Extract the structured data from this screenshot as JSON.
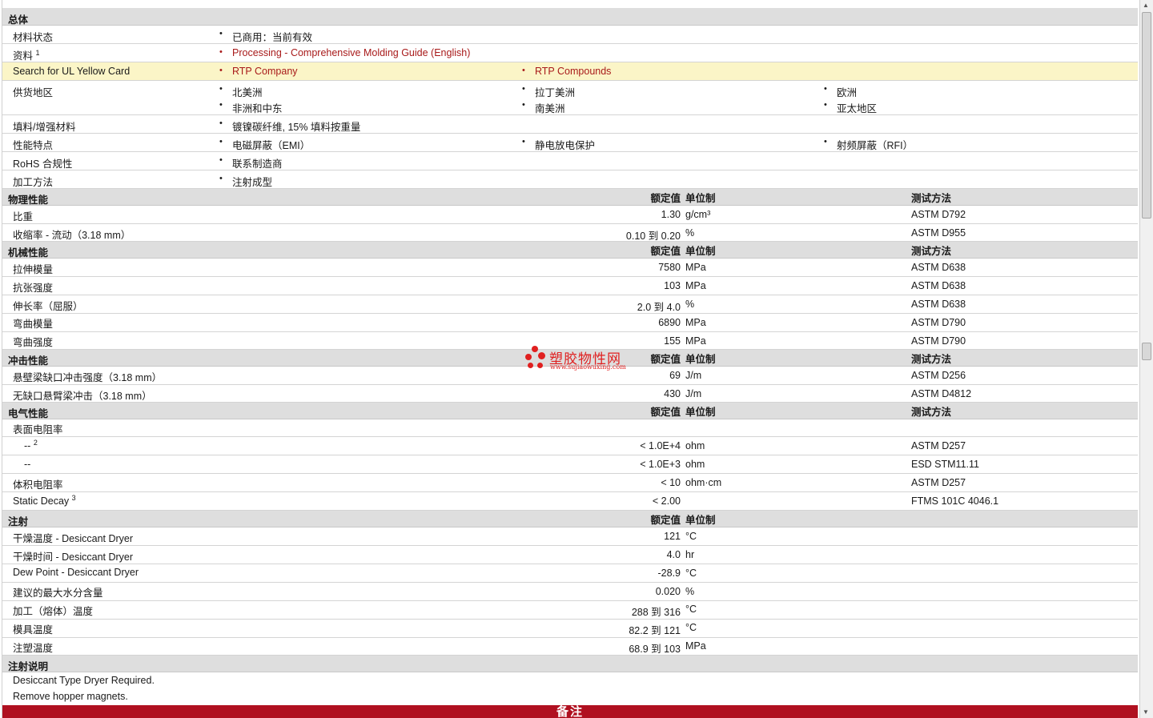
{
  "general": {
    "title": "总体",
    "status_label": "材料状态",
    "status_value": "已商用：当前有效",
    "docs_label": "资料",
    "docs_sup": "1",
    "docs_link": "Processing - Comprehensive Molding Guide (English)",
    "ul_label": "Search for UL Yellow Card",
    "ul_link1": "RTP Company",
    "ul_link2": "RTP Compounds",
    "supply_label": "供货地区",
    "supply": [
      "北美洲",
      "拉丁美洲",
      "欧洲",
      "非洲和中东",
      "南美洲",
      "亚太地区"
    ],
    "filler_label": "填料/增强材料",
    "filler_value": "镀镍碳纤维, 15% 填料按重量",
    "features_label": "性能特点",
    "features": [
      "电磁屏蔽（EMI）",
      "静电放电保护",
      "射频屏蔽（RFI）"
    ],
    "rohs_label": "RoHS 合规性",
    "rohs_value": "联系制造商",
    "process_label": "加工方法",
    "process_value": "注射成型"
  },
  "headers": {
    "value": "额定值",
    "unit": "单位制",
    "method": "测试方法"
  },
  "physical": {
    "title": "物理性能",
    "rows": [
      {
        "label": "比重",
        "value": "1.30",
        "unit": "g/cm³",
        "method": "ASTM D792"
      },
      {
        "label": "收缩率  - 流动（3.18 mm）",
        "value": "0.10 到  0.20",
        "unit": "%",
        "method": "ASTM D955"
      }
    ]
  },
  "mechanical": {
    "title": "机械性能",
    "rows": [
      {
        "label": "拉伸模量",
        "value": "7580",
        "unit": "MPa",
        "method": "ASTM D638"
      },
      {
        "label": "抗张强度",
        "value": "103",
        "unit": "MPa",
        "method": "ASTM D638"
      },
      {
        "label": "伸长率（屈服）",
        "value": "2.0 到  4.0",
        "unit": "%",
        "method": "ASTM D638"
      },
      {
        "label": "弯曲模量",
        "value": "6890",
        "unit": "MPa",
        "method": "ASTM D790"
      },
      {
        "label": "弯曲强度",
        "value": "155",
        "unit": "MPa",
        "method": "ASTM D790"
      }
    ]
  },
  "impact": {
    "title": "冲击性能",
    "rows": [
      {
        "label": "悬壁梁缺口冲击强度（3.18 mm）",
        "value": "69",
        "unit": "J/m",
        "method": "ASTM D256"
      },
      {
        "label": "无缺口悬臂梁冲击（3.18 mm）",
        "value": "430",
        "unit": "J/m",
        "method": "ASTM D4812"
      }
    ]
  },
  "electrical": {
    "title": "电气性能",
    "surface_label": "表面电阻率",
    "rows": [
      {
        "label": "--",
        "sup": "2",
        "value": "< 1.0E+4",
        "unit": "ohm",
        "method": "ASTM D257"
      },
      {
        "label": "--",
        "sup": "",
        "value": "< 1.0E+3",
        "unit": "ohm",
        "method": "ESD STM11.11"
      },
      {
        "label": "体积电阻率",
        "sup": "",
        "value": "< 10",
        "unit": "ohm·cm",
        "method": "ASTM D257"
      },
      {
        "label": "Static Decay",
        "sup": "3",
        "value": "< 2.00",
        "unit": "",
        "method": "FTMS 101C 4046.1"
      }
    ]
  },
  "injection": {
    "title": "注射",
    "rows": [
      {
        "label": "干燥温度  - Desiccant Dryer",
        "value": "121",
        "unit": "°C"
      },
      {
        "label": "干燥时间  - Desiccant Dryer",
        "value": "4.0",
        "unit": "hr"
      },
      {
        "label": "Dew Point - Desiccant Dryer",
        "value": "-28.9",
        "unit": "°C"
      },
      {
        "label": "建议的最大水分含量",
        "value": "0.020",
        "unit": "%"
      },
      {
        "label": "加工（熔体）温度",
        "value": "288 到  316",
        "unit": "°C"
      },
      {
        "label": "模具温度",
        "value": "82.2 到  121",
        "unit": "°C"
      },
      {
        "label": "注塑温度",
        "value": "68.9 到  103",
        "unit": "MPa"
      }
    ]
  },
  "notes": {
    "title": "注射说明",
    "line1": "Desiccant Type Dryer Required.",
    "line2": "Remove hopper magnets."
  },
  "remarks_title": "备注",
  "watermark": {
    "name": "塑胶物性网",
    "url": "www.sujiaowuxing.com"
  }
}
